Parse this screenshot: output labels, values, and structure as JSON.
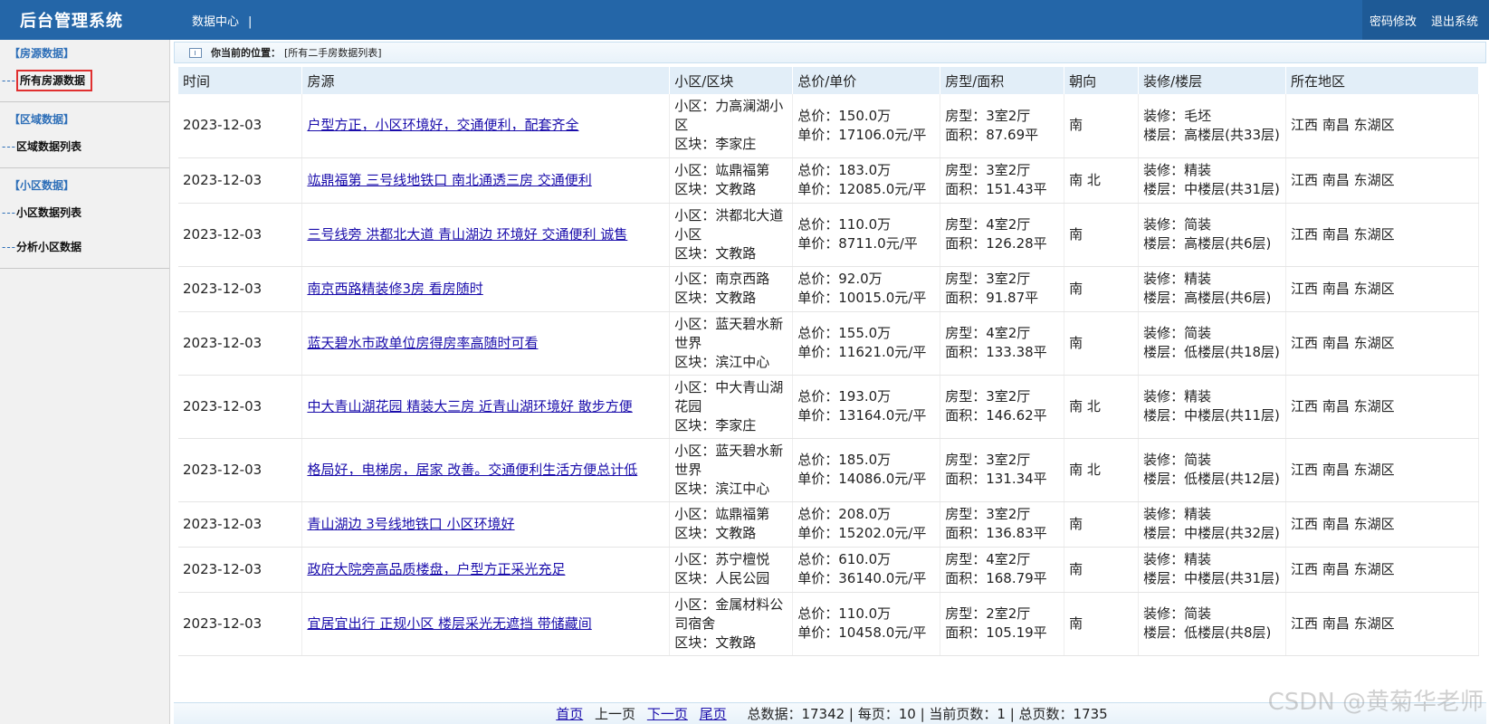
{
  "header": {
    "brand": "后台管理系统",
    "nav": "数据中心",
    "nav_sep": "|",
    "change_password": "密码修改",
    "logout": "退出系统"
  },
  "sidebar": {
    "groups": [
      {
        "title": "【房源数据】",
        "items": [
          {
            "label": "所有房源数据",
            "dash": "---"
          }
        ]
      },
      {
        "title": "【区域数据】",
        "items": [
          {
            "label": "区域数据列表",
            "dash": "---"
          }
        ]
      },
      {
        "title": "【小区数据】",
        "items": [
          {
            "label": "小区数据列表",
            "dash": "---"
          },
          {
            "label": "分析小区数据",
            "dash": "---"
          }
        ]
      }
    ]
  },
  "breadcrumb": {
    "label": "你当前的位置：",
    "value": "[所有二手房数据列表]"
  },
  "table": {
    "headers": [
      "时间",
      "房源",
      "小区/区块",
      "总价/单价",
      "房型/面积",
      "朝向",
      "装修/楼层",
      "所在地区"
    ],
    "rows": [
      {
        "time": "2023-12-03",
        "title": "户型方正，小区环境好，交通便利，配套齐全",
        "xq": "小区：力高澜湖小区",
        "qk": "区块：李家庄",
        "total": "总价：150.0万",
        "unit": "单价：17106.0元/平",
        "type": "房型：3室2厅",
        "area": "面积：87.69平",
        "orient": "南",
        "deco": "装修：毛坯",
        "floor": "楼层：高楼层(共33层)",
        "region": "江西 南昌 东湖区"
      },
      {
        "time": "2023-12-03",
        "title": "竑鼎福第 三号线地铁口 南北通透三房 交通便利",
        "xq": "小区：竑鼎福第",
        "qk": "区块：文教路",
        "total": "总价：183.0万",
        "unit": "单价：12085.0元/平",
        "type": "房型：3室2厅",
        "area": "面积：151.43平",
        "orient": "南 北",
        "deco": "装修：精装",
        "floor": "楼层：中楼层(共31层)",
        "region": "江西 南昌 东湖区"
      },
      {
        "time": "2023-12-03",
        "title": "三号线旁 洪都北大道 青山湖边 环境好 交通便利 诚售",
        "xq": "小区：洪都北大道小区",
        "qk": "区块：文教路",
        "total": "总价：110.0万",
        "unit": "单价：8711.0元/平",
        "type": "房型：4室2厅",
        "area": "面积：126.28平",
        "orient": "南",
        "deco": "装修：简装",
        "floor": "楼层：高楼层(共6层)",
        "region": "江西 南昌 东湖区"
      },
      {
        "time": "2023-12-03",
        "title": "南京西路精装修3房 看房随时",
        "xq": "小区：南京西路",
        "qk": "区块：文教路",
        "total": "总价：92.0万",
        "unit": "单价：10015.0元/平",
        "type": "房型：3室2厅",
        "area": "面积：91.87平",
        "orient": "南",
        "deco": "装修：精装",
        "floor": "楼层：高楼层(共6层)",
        "region": "江西 南昌 东湖区"
      },
      {
        "time": "2023-12-03",
        "title": "蓝天碧水市政单位房得房率高随时可看",
        "xq": "小区：蓝天碧水新世界",
        "qk": "区块：滨江中心",
        "total": "总价：155.0万",
        "unit": "单价：11621.0元/平",
        "type": "房型：4室2厅",
        "area": "面积：133.38平",
        "orient": "南",
        "deco": "装修：简装",
        "floor": "楼层：低楼层(共18层)",
        "region": "江西 南昌 东湖区"
      },
      {
        "time": "2023-12-03",
        "title": "中大青山湖花园 精装大三房 近青山湖环境好 散步方便",
        "xq": "小区：中大青山湖花园",
        "qk": "区块：李家庄",
        "total": "总价：193.0万",
        "unit": "单价：13164.0元/平",
        "type": "房型：3室2厅",
        "area": "面积：146.62平",
        "orient": "南 北",
        "deco": "装修：精装",
        "floor": "楼层：中楼层(共11层)",
        "region": "江西 南昌 东湖区"
      },
      {
        "time": "2023-12-03",
        "title": "格局好，电梯房，居家 改善。交通便利生活方便总计低",
        "xq": "小区：蓝天碧水新世界",
        "qk": "区块：滨江中心",
        "total": "总价：185.0万",
        "unit": "单价：14086.0元/平",
        "type": "房型：3室2厅",
        "area": "面积：131.34平",
        "orient": "南 北",
        "deco": "装修：简装",
        "floor": "楼层：低楼层(共12层)",
        "region": "江西 南昌 东湖区"
      },
      {
        "time": "2023-12-03",
        "title": "青山湖边 3号线地铁口 小区环境好",
        "xq": "小区：竑鼎福第",
        "qk": "区块：文教路",
        "total": "总价：208.0万",
        "unit": "单价：15202.0元/平",
        "type": "房型：3室2厅",
        "area": "面积：136.83平",
        "orient": "南",
        "deco": "装修：精装",
        "floor": "楼层：中楼层(共32层)",
        "region": "江西 南昌 东湖区"
      },
      {
        "time": "2023-12-03",
        "title": "政府大院旁高品质楼盘，户型方正采光充足",
        "xq": "小区：苏宁檀悦",
        "qk": "区块：人民公园",
        "total": "总价：610.0万",
        "unit": "单价：36140.0元/平",
        "type": "房型：4室2厅",
        "area": "面积：168.79平",
        "orient": "南",
        "deco": "装修：精装",
        "floor": "楼层：中楼层(共31层)",
        "region": "江西 南昌 东湖区"
      },
      {
        "time": "2023-12-03",
        "title": "宜居宜出行 正规小区 楼层采光无遮挡 带储藏间",
        "xq": "小区：金属材料公司宿舍",
        "qk": "区块：文教路",
        "total": "总价：110.0万",
        "unit": "单价：10458.0元/平",
        "type": "房型：2室2厅",
        "area": "面积：105.19平",
        "orient": "南",
        "deco": "装修：简装",
        "floor": "楼层：低楼层(共8层)",
        "region": "江西 南昌 东湖区"
      }
    ]
  },
  "pager": {
    "first": "首页",
    "prev": "上一页",
    "next": "下一页",
    "last": "尾页",
    "stats": "总数据：17342 | 每页：10 | 当前页数：1 | 总页数：1735"
  },
  "watermark": "CSDN @黄菊华老师"
}
